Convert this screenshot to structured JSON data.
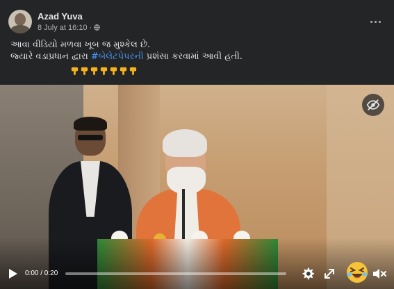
{
  "post": {
    "author": "Azad Yuva",
    "timestamp": "8 July at 16:10",
    "separator": "·",
    "privacy_icon": "globe-icon",
    "more_icon": "more-horizontal-icon",
    "text_line_1": "આવા વીડિયો મળવા ખૂબ જ મુશ્કેલ છે.",
    "text_line_2_before": "જ્યારે વડાપ્રધાન દ્વારા ",
    "hashtag": "#બેલેટપેપરની",
    "text_line_2_after": " પ્રશંસા કરવામાં આવી હતી.",
    "emoji_icon": "backhand-index-pointing-down-icon",
    "emoji_count": 7
  },
  "video": {
    "hide_icon": "eye-slash-icon",
    "time": "0:00 / 0:20",
    "progress": 0.0,
    "play_icon": "play-icon",
    "settings_icon": "gear-icon",
    "fullscreen_icon": "fullscreen-icon",
    "reaction_icon": "laughing-emoji-icon",
    "volume_icon": "volume-muted-icon"
  },
  "colors": {
    "background": "#242526",
    "text": "#e4e6eb",
    "secondary_text": "#b0b3b8",
    "hashtag": "#4599ff",
    "emoji": "#f6b21d"
  }
}
